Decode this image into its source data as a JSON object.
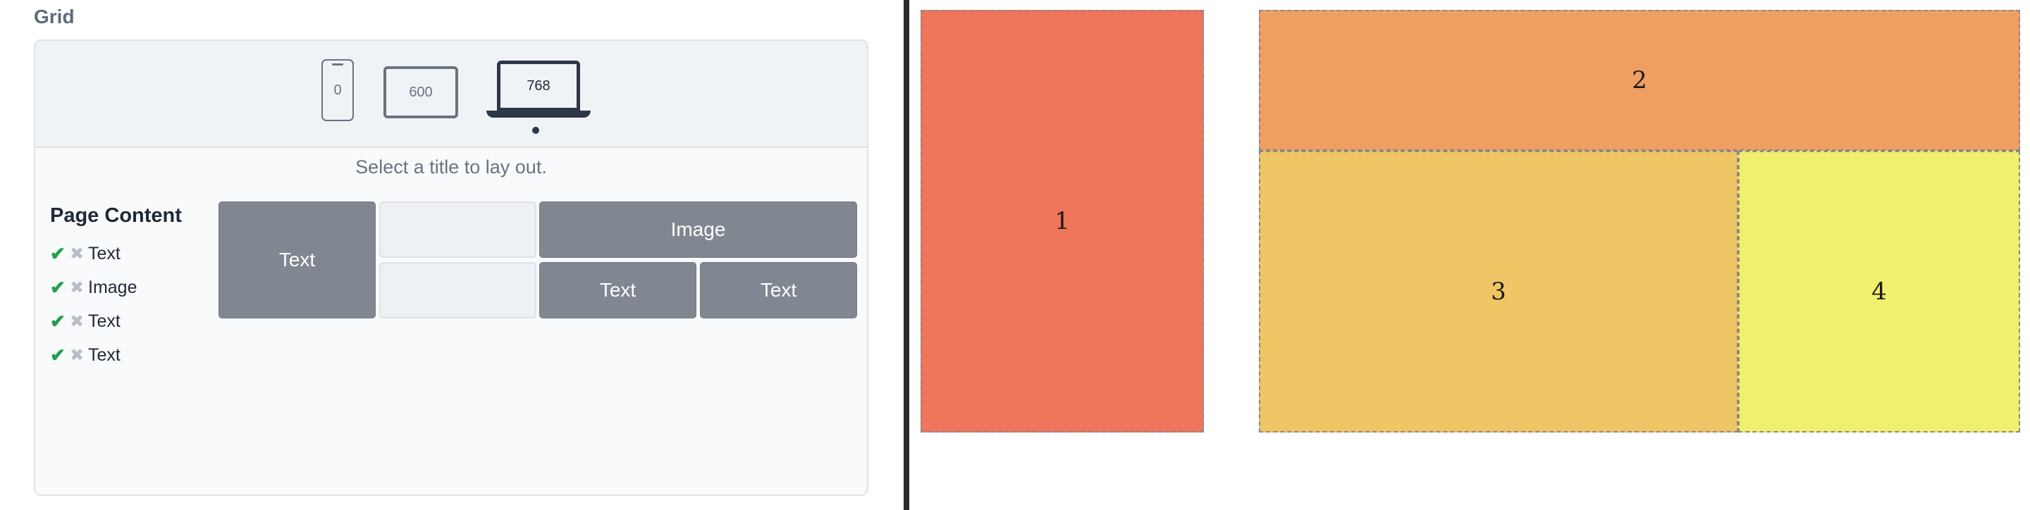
{
  "section_title": "Grid",
  "breakpoints": [
    {
      "label": "0",
      "device": "phone",
      "active": false
    },
    {
      "label": "600",
      "device": "tablet",
      "active": false
    },
    {
      "label": "768",
      "device": "laptop",
      "active": true
    }
  ],
  "hint": "Select a title to lay out.",
  "page_content": {
    "title": "Page Content",
    "items": [
      {
        "label": "Text"
      },
      {
        "label": "Image"
      },
      {
        "label": "Text"
      },
      {
        "label": "Text"
      }
    ]
  },
  "layout_cells": {
    "text_1": "Text",
    "image": "Image",
    "text_2": "Text",
    "text_3": "Text"
  },
  "preview": {
    "blocks": [
      {
        "label": "1",
        "color": "#ef765d"
      },
      {
        "label": "2",
        "color": "#ef9f62"
      },
      {
        "label": "3",
        "color": "#efc566"
      },
      {
        "label": "4",
        "color": "#f0ef6e"
      }
    ]
  },
  "colors": {
    "check": "#22a04b",
    "cross": "#b8bec6",
    "filled_cell": "#818790",
    "divider": "#2b2b2b"
  }
}
